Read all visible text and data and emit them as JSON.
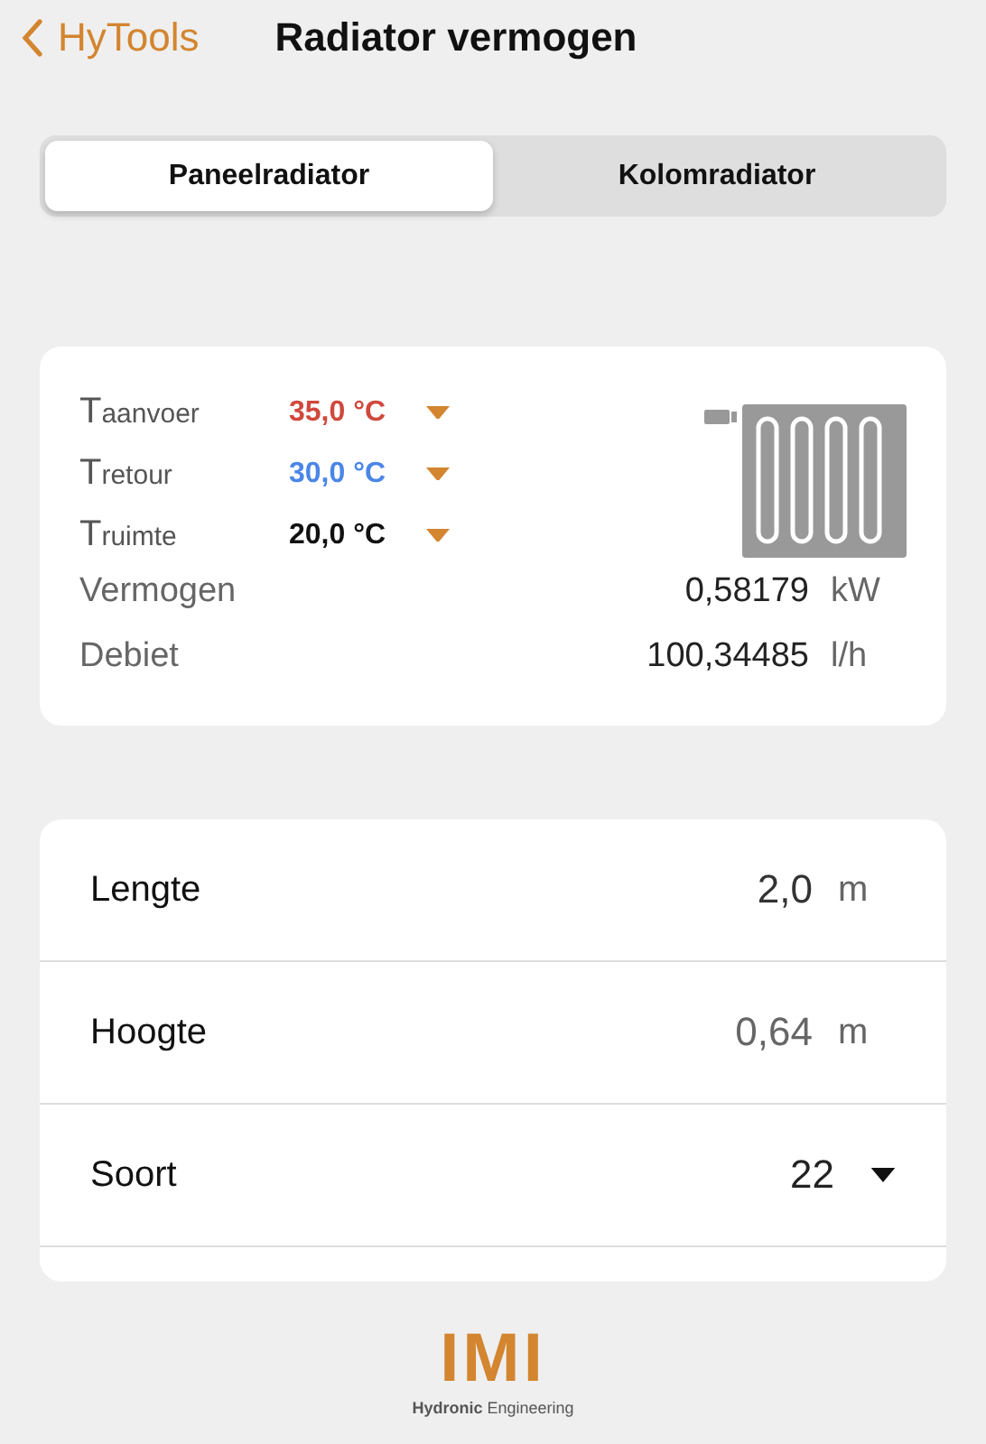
{
  "nav": {
    "back": "HyTools",
    "title": "Radiator vermogen"
  },
  "segments": [
    {
      "label": "Paneelradiator",
      "selected": true
    },
    {
      "label": "Kolomradiator",
      "selected": false
    }
  ],
  "temperatures": [
    {
      "symbol": "T",
      "sub": "aanvoer",
      "value": "35,0 °C",
      "color": "#d0483c"
    },
    {
      "symbol": "T",
      "sub": "retour",
      "value": "30,0 °C",
      "color": "#4a86e8"
    },
    {
      "symbol": "T",
      "sub": "ruimte",
      "value": "20,0 °C",
      "color": "#111111"
    }
  ],
  "results": [
    {
      "label": "Vermogen",
      "value": "0,58179",
      "unit": "kW"
    },
    {
      "label": "Debiet",
      "value": "100,34485",
      "unit": "l/h"
    }
  ],
  "inputs": [
    {
      "kind": "field",
      "label": "Lengte",
      "value": "2,0",
      "unit": "m",
      "dim": false
    },
    {
      "kind": "field",
      "label": "Hoogte",
      "value": "0,64",
      "unit": "m",
      "dim": true
    },
    {
      "kind": "select",
      "label": "Soort",
      "value": "22"
    }
  ],
  "logo": {
    "mark": "IMI",
    "tagline": "**Hydronic** Engineering"
  }
}
